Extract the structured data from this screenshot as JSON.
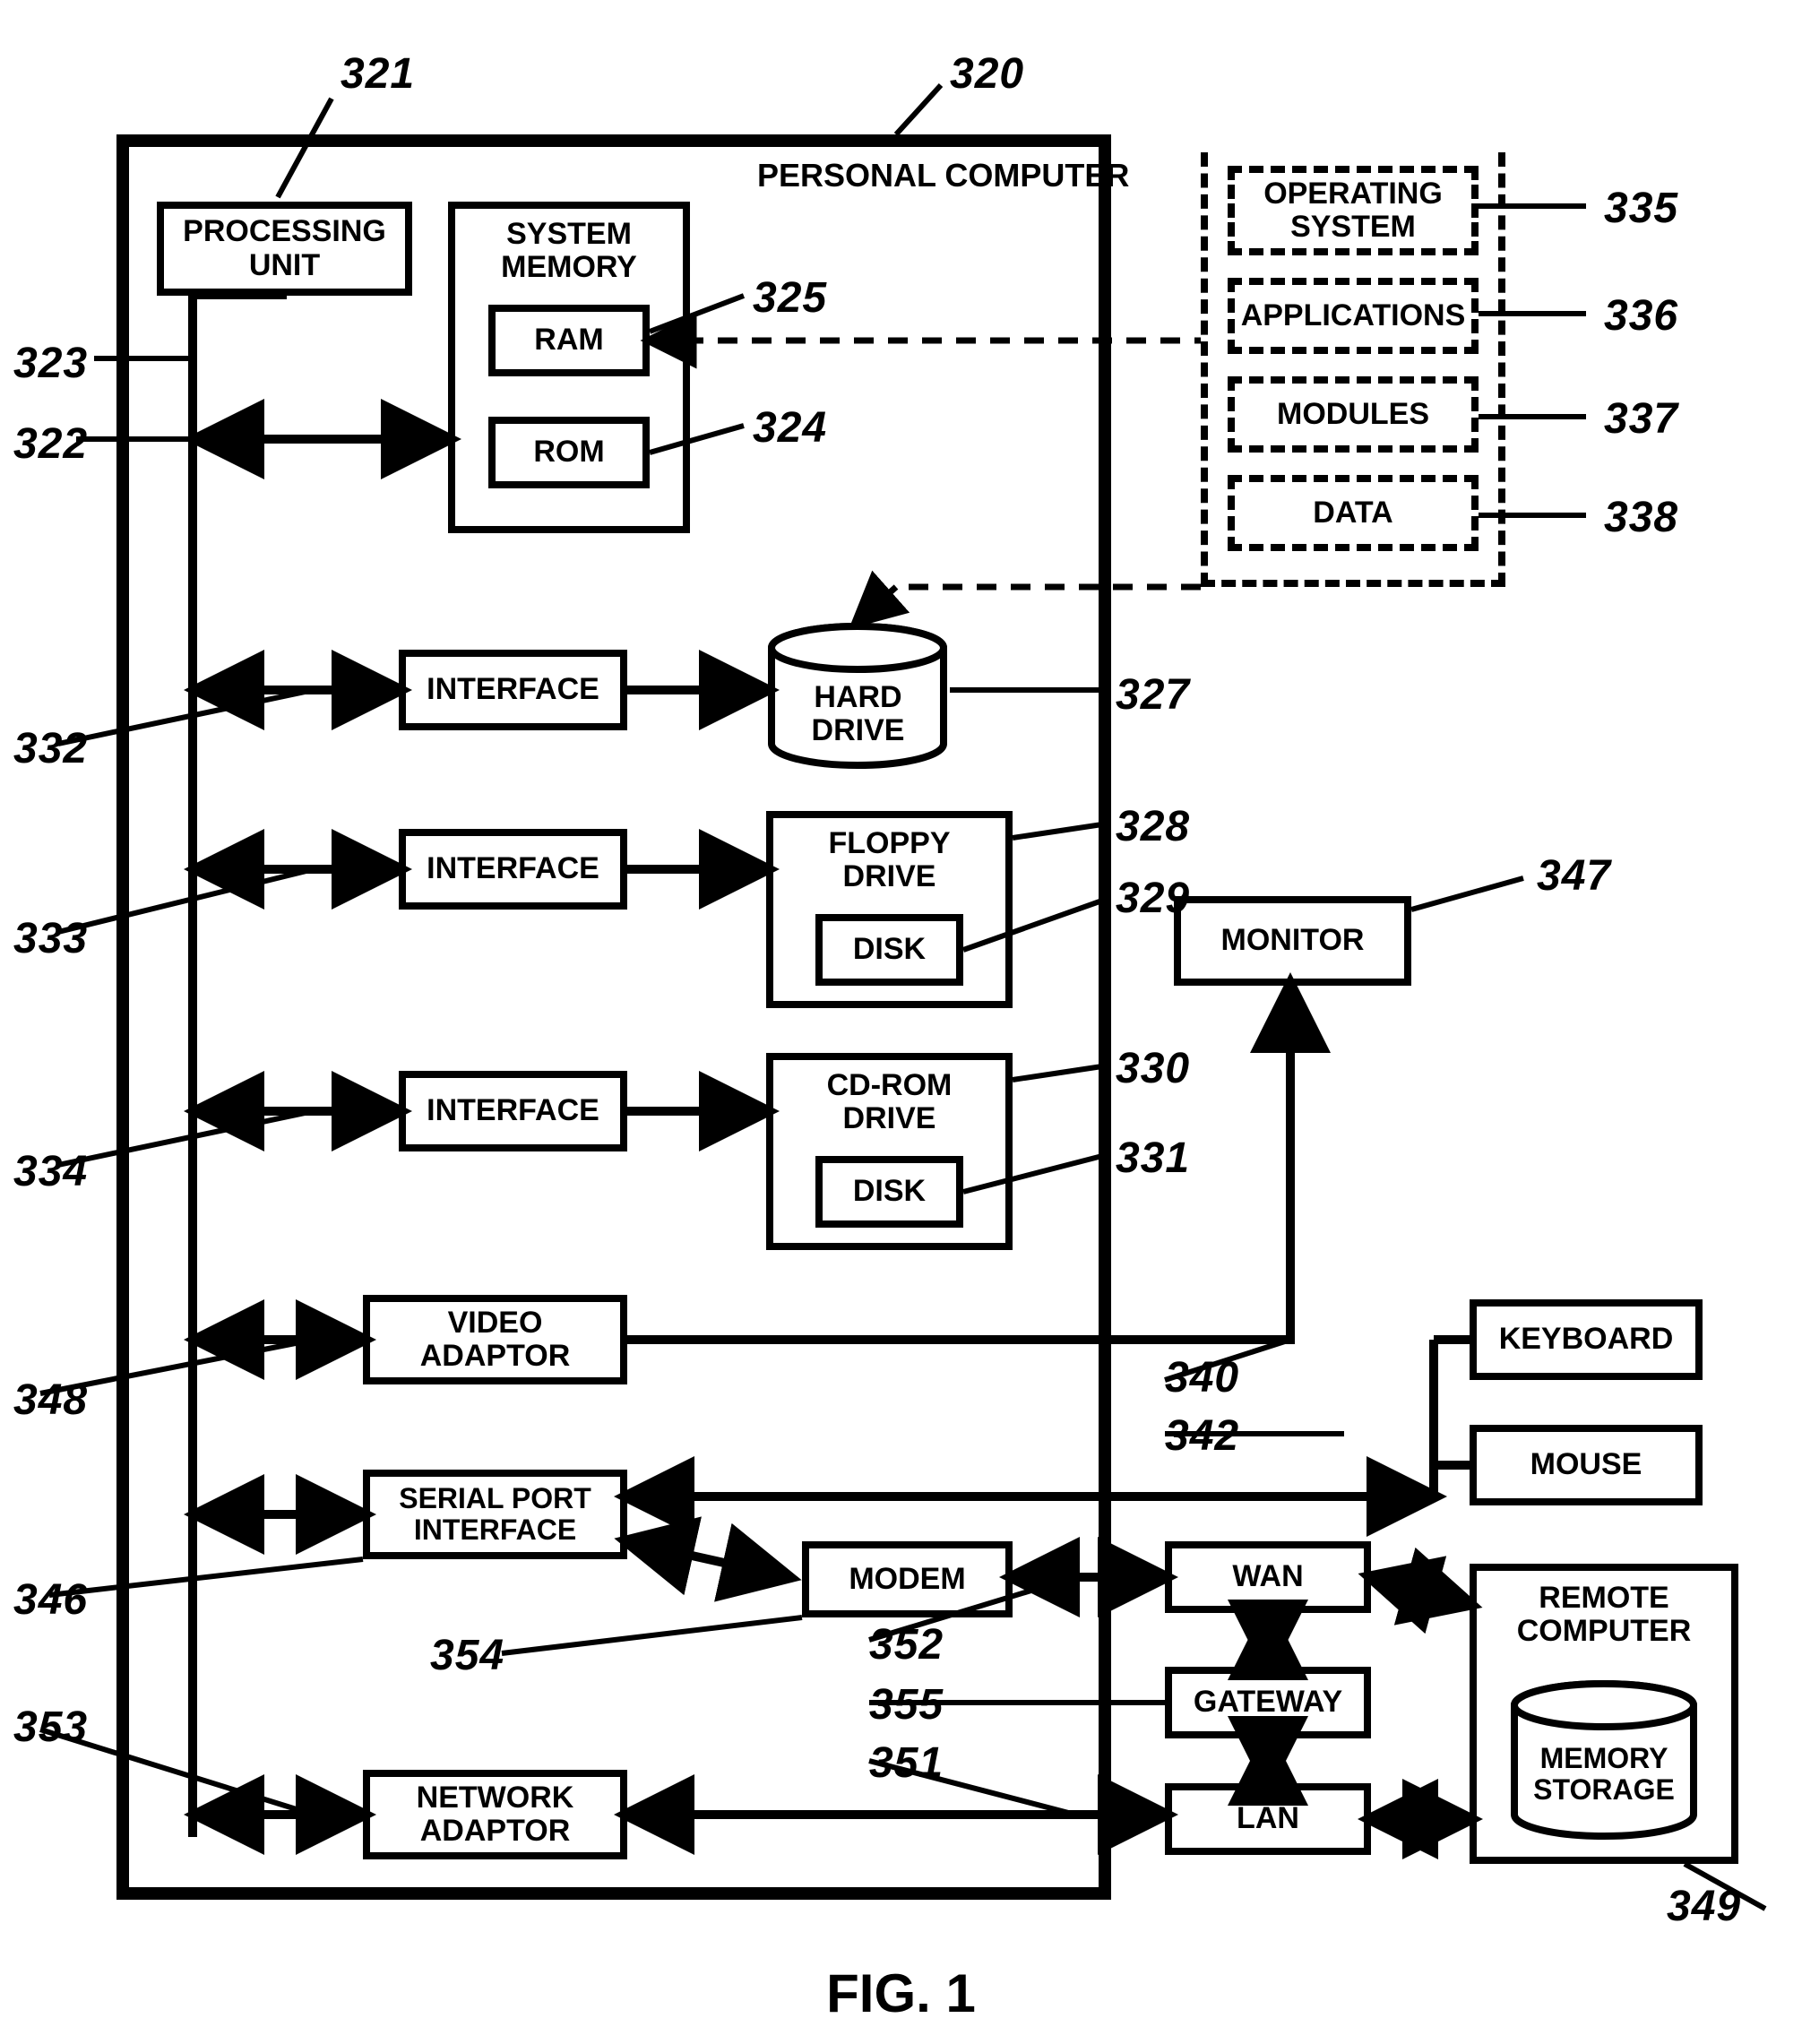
{
  "figure": "FIG. 1",
  "pc": {
    "title": "PERSONAL COMPUTER",
    "processing_unit": "PROCESSING\nUNIT",
    "system_memory": "SYSTEM\nMEMORY",
    "ram": "RAM",
    "rom": "ROM",
    "interface": "INTERFACE",
    "hard_drive": "HARD\nDRIVE",
    "floppy_drive": "FLOPPY\nDRIVE",
    "floppy_disk": "DISK",
    "cdrom_drive": "CD-ROM\nDRIVE",
    "cdrom_disk": "DISK",
    "video_adaptor": "VIDEO\nADAPTOR",
    "serial_port_interface": "SERIAL PORT\nINTERFACE",
    "modem": "MODEM",
    "network_adaptor": "NETWORK\nADAPTOR"
  },
  "ext": {
    "operating_system": "OPERATING\nSYSTEM",
    "applications": "APPLICATIONS",
    "modules": "MODULES",
    "data": "DATA",
    "monitor": "MONITOR",
    "keyboard": "KEYBOARD",
    "mouse": "MOUSE",
    "wan": "WAN",
    "gateway": "GATEWAY",
    "lan": "LAN",
    "remote_computer": "REMOTE\nCOMPUTER",
    "memory_storage": "MEMORY\nSTORAGE"
  },
  "refs": {
    "r320": "320",
    "r321": "321",
    "r322": "322",
    "r323": "323",
    "r324": "324",
    "r325": "325",
    "r327": "327",
    "r328": "328",
    "r329": "329",
    "r330": "330",
    "r331": "331",
    "r332": "332",
    "r333": "333",
    "r334": "334",
    "r335": "335",
    "r336": "336",
    "r337": "337",
    "r338": "338",
    "r340": "340",
    "r342": "342",
    "r346": "346",
    "r347": "347",
    "r348": "348",
    "r349": "349",
    "r351": "351",
    "r352": "352",
    "r353": "353",
    "r354": "354",
    "r355": "355"
  }
}
